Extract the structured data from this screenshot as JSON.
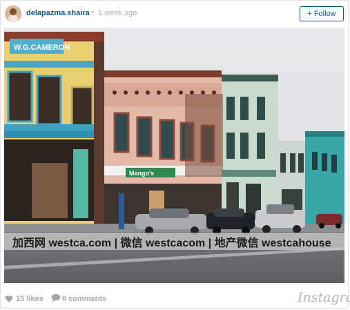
{
  "post": {
    "username": "delapazma.shaira",
    "separator": "•",
    "time": "1 week ago",
    "follow_label": "+ Follow"
  },
  "photo": {
    "sign_left": "W.G.CAMERON",
    "sign_store": "Mango's",
    "watermark": "加西网 westca.com | 微信 westcacom | 地产微信 westcahouse"
  },
  "footer": {
    "likes": "15 likes",
    "comments": "0 comments",
    "brand": "Instagram"
  },
  "icons": {
    "likes": "heart-icon",
    "comments": "speech-bubble-icon"
  },
  "colors": {
    "accent": "#125688",
    "muted": "#a5a7aa"
  }
}
